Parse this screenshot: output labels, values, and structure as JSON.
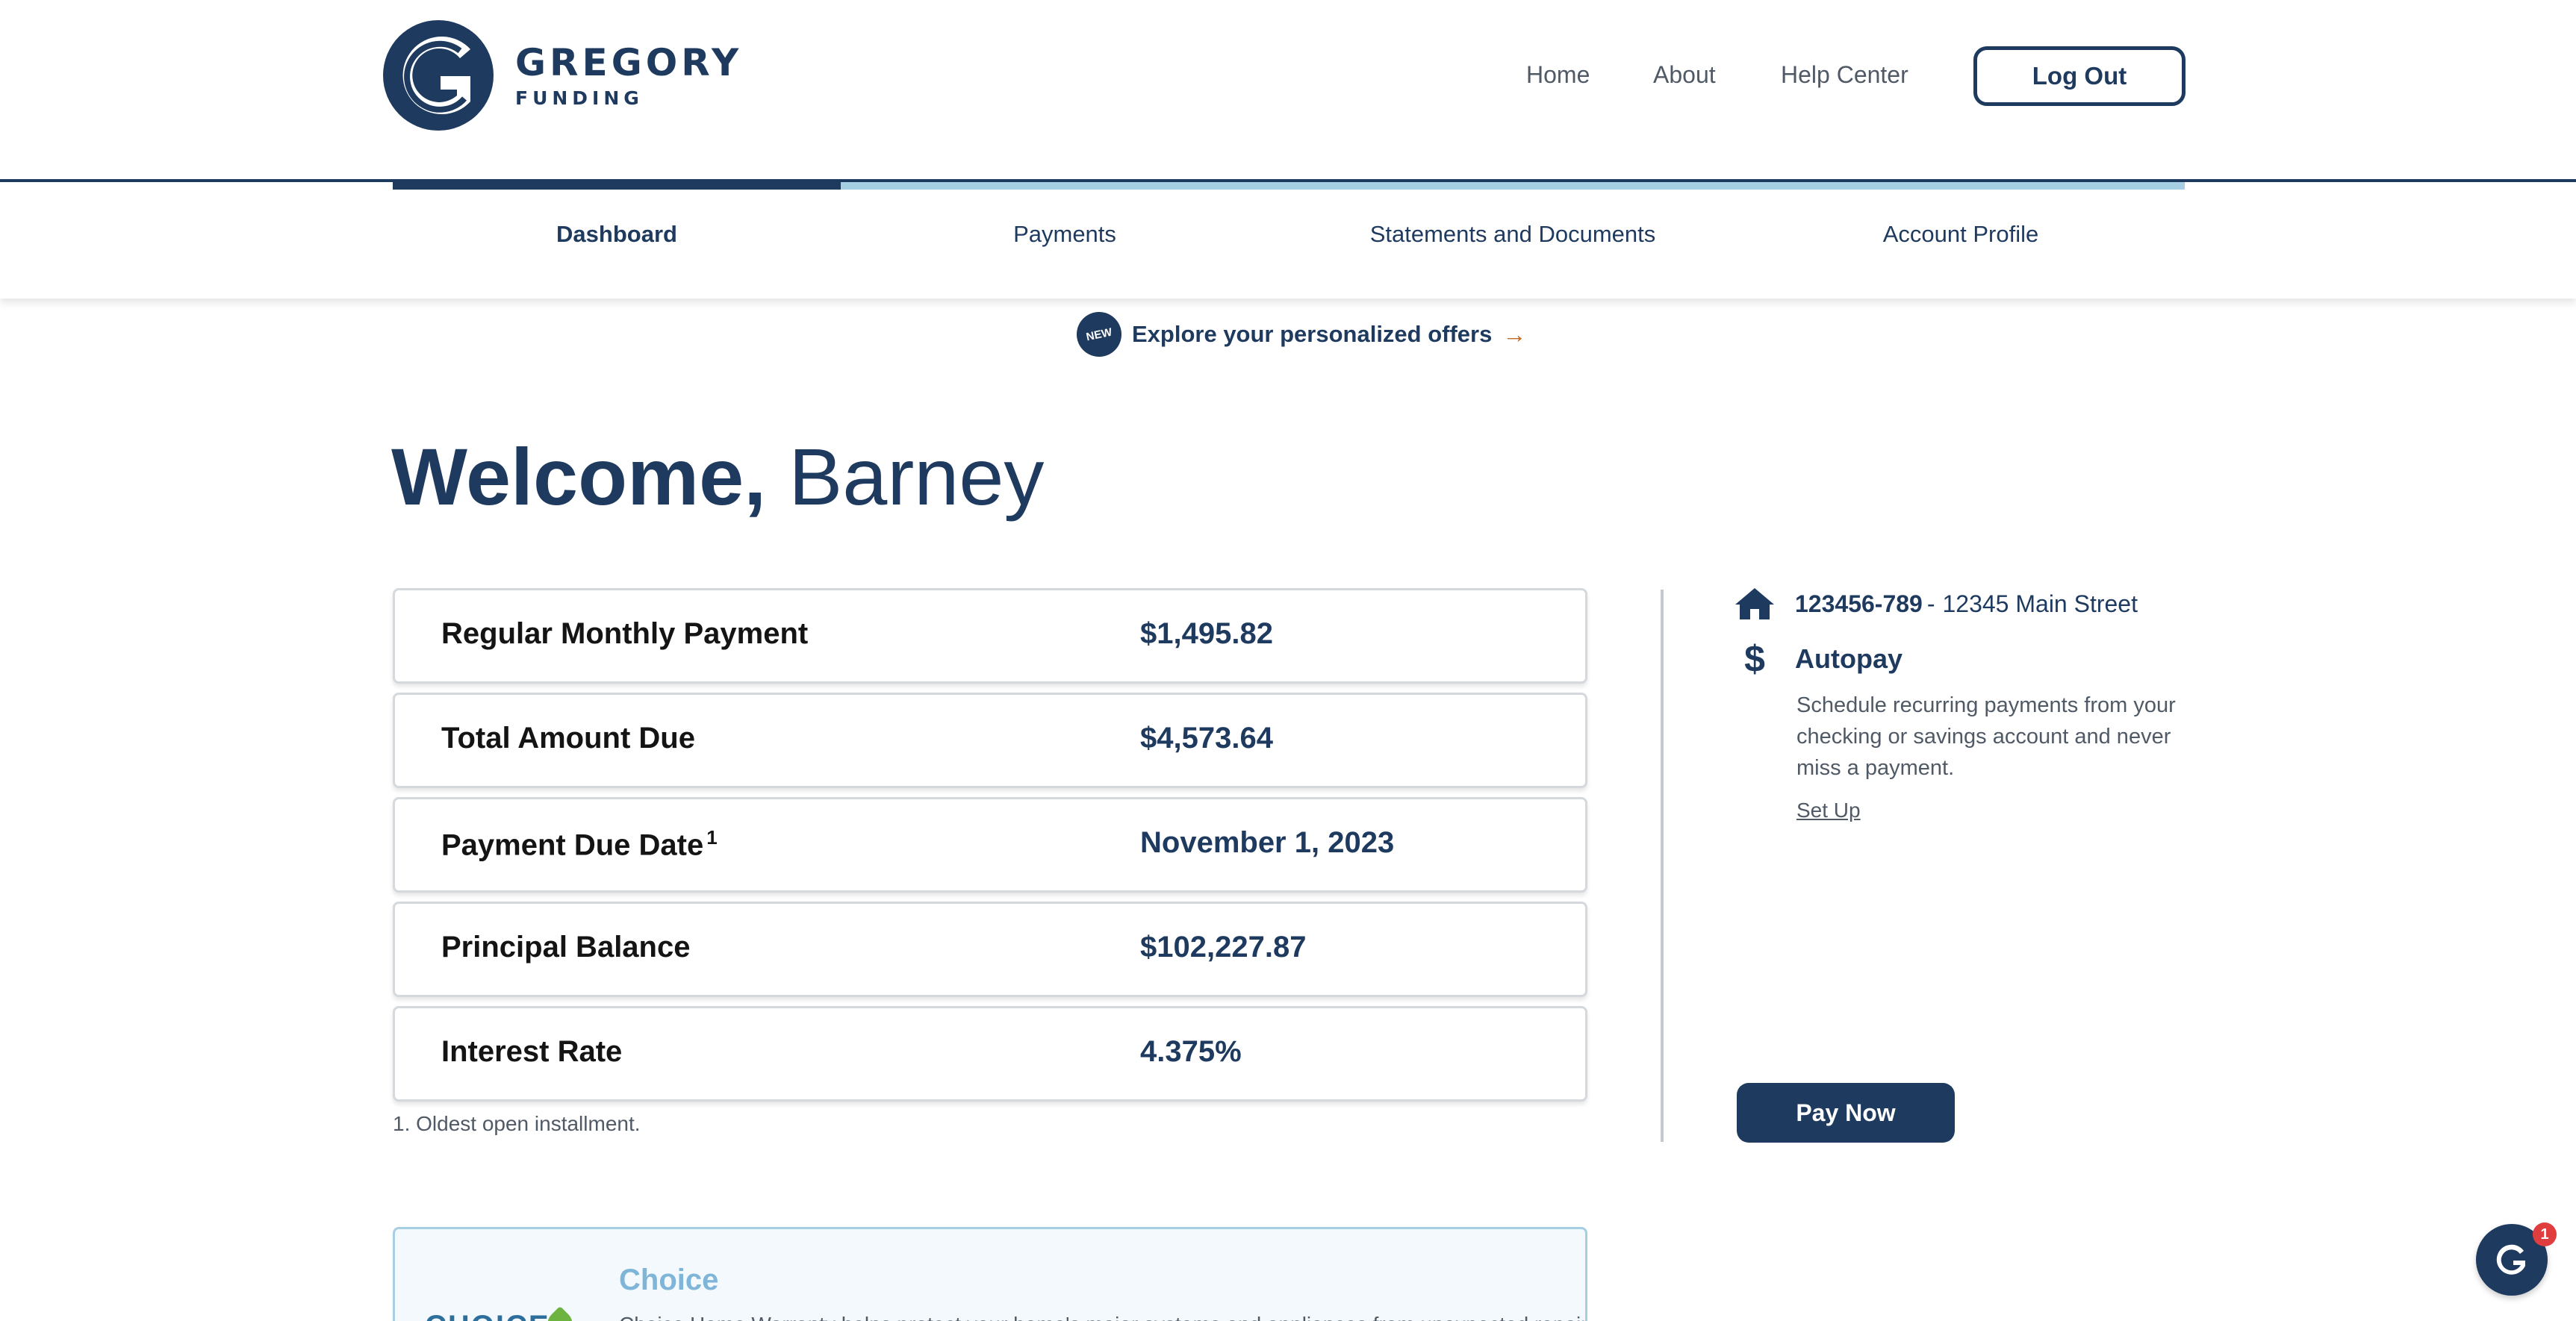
{
  "brand": {
    "name": "GREGORY",
    "sub": "FUNDING",
    "primary_color": "#1f3a5f",
    "accent_color": "#a7cfe3",
    "arrow_color": "#c26a1e"
  },
  "topnav": {
    "home": "Home",
    "about": "About",
    "help": "Help Center",
    "logout": "Log Out"
  },
  "tabs": [
    {
      "label": "Dashboard",
      "active": true
    },
    {
      "label": "Payments",
      "active": false
    },
    {
      "label": "Statements and Documents",
      "active": false
    },
    {
      "label": "Account Profile",
      "active": false
    }
  ],
  "offers": {
    "badge": "NEW",
    "text": "Explore your personalized offers",
    "arrow": "→"
  },
  "welcome": {
    "greeting": "Welcome,",
    "name": "Barney"
  },
  "summary": [
    {
      "label": "Regular Monthly Payment",
      "value": "$1,495.82"
    },
    {
      "label": "Total Amount Due",
      "value": "$4,573.64"
    },
    {
      "label": "Payment Due Date",
      "footnote_ref": "1",
      "value": "November 1, 2023"
    },
    {
      "label": "Principal Balance",
      "value": "$102,227.87"
    },
    {
      "label": "Interest Rate",
      "value": "4.375%"
    }
  ],
  "footnote": "1. Oldest open installment.",
  "account": {
    "icon": "home-icon",
    "number": "123456-789",
    "separator": " - ",
    "address": "12345 Main Street"
  },
  "autopay": {
    "icon": "dollar-icon",
    "symbol": "$",
    "title": "Autopay",
    "description": "Schedule recurring payments from your checking or savings account and never miss a payment.",
    "setup_label": "Set Up"
  },
  "pay_now": "Pay Now",
  "choice": {
    "title": "Choice",
    "body": "Choice Home Warranty helps protect your home's major systems and appliances from unexpected repair costs."
  },
  "chat": {
    "icon": "chat-logo-icon",
    "badge": "1"
  }
}
